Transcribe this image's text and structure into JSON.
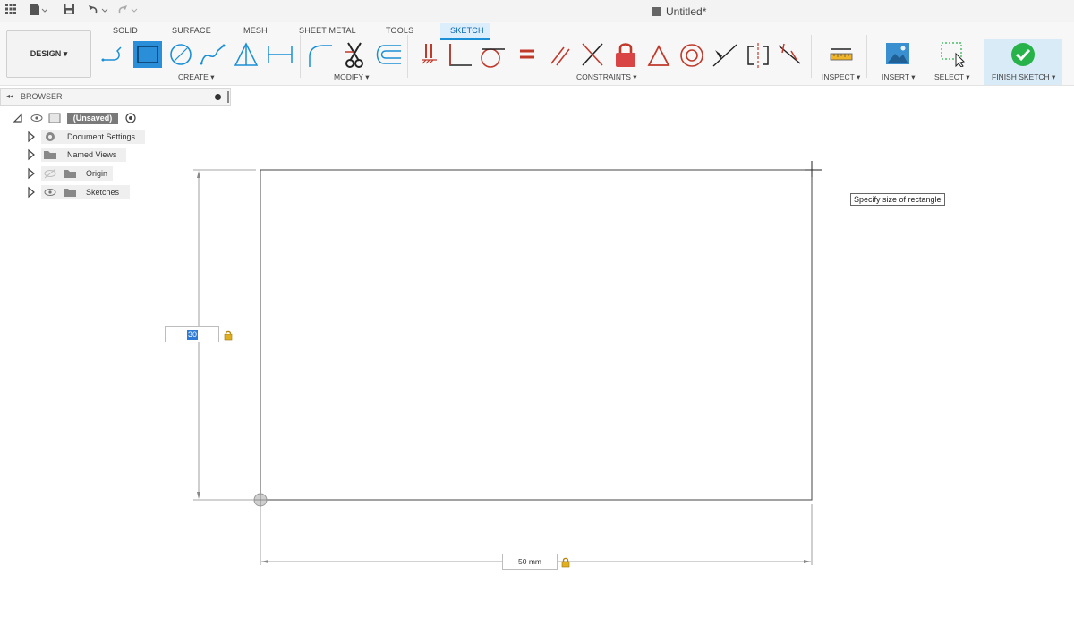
{
  "title_bar": {
    "document_title": "Untitled*"
  },
  "workspace": {
    "design_label": "DESIGN ▾"
  },
  "tabs": [
    {
      "label": "SOLID"
    },
    {
      "label": "SURFACE"
    },
    {
      "label": "MESH"
    },
    {
      "label": "SHEET METAL"
    },
    {
      "label": "TOOLS"
    },
    {
      "label": "SKETCH",
      "active": true
    }
  ],
  "groups": {
    "create": "CREATE ▾",
    "modify": "MODIFY ▾",
    "constraints": "CONSTRAINTS ▾",
    "inspect": "INSPECT ▾",
    "insert": "INSERT ▾",
    "select": "SELECT ▾",
    "finish": "FINISH SKETCH ▾"
  },
  "icons": {
    "apps": "grid-icon",
    "file": "file-icon",
    "save": "save-icon",
    "undo": "undo-icon",
    "redo": "redo-icon",
    "create": [
      "line-icon",
      "rectangle-icon",
      "circle-icon",
      "spline-icon",
      "triangle-icon",
      "dimension-icon"
    ],
    "modify": [
      "fillet-icon",
      "trim-icon",
      "offset-icon"
    ],
    "constraints": [
      "fix-icon",
      "coincident-icon",
      "tangent-icon",
      "equal-icon",
      "parallel-icon",
      "perpendicular-icon",
      "lock-icon",
      "horizontal-vertical-icon",
      "concentric-icon",
      "midpoint-icon",
      "symmetry-icon",
      "collinear-icon"
    ],
    "finish": "checkmark-icon"
  },
  "colors": {
    "accent": "#1b8fd6",
    "finish_green": "#27b24a",
    "constraint_red": "#c0392b",
    "finish_bg": "#d9ebf7"
  },
  "browser": {
    "header": "BROWSER",
    "collapse_glyph": "◂◂",
    "root": "(Unsaved)",
    "items": [
      {
        "label": "Document Settings"
      },
      {
        "label": "Named Views"
      },
      {
        "label": "Origin"
      },
      {
        "label": "Sketches"
      }
    ]
  },
  "canvas": {
    "tooltip": "Specify size of rectangle",
    "height_value": "30",
    "width_value": "50 mm"
  }
}
